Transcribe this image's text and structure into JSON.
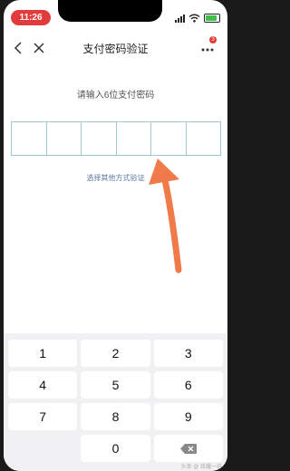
{
  "status_bar": {
    "time": "11:26"
  },
  "nav": {
    "title": "支付密码验证",
    "badge": "3"
  },
  "prompt": "请输入6位支付密码",
  "other_method": "选择其他方式验证",
  "keypad": {
    "rows": [
      [
        "1",
        "2",
        "3"
      ],
      [
        "4",
        "5",
        "6"
      ],
      [
        "7",
        "8",
        "9"
      ],
      [
        "",
        "0",
        "delete"
      ]
    ]
  },
  "watermark": "头条 @ 炫耀一坊"
}
